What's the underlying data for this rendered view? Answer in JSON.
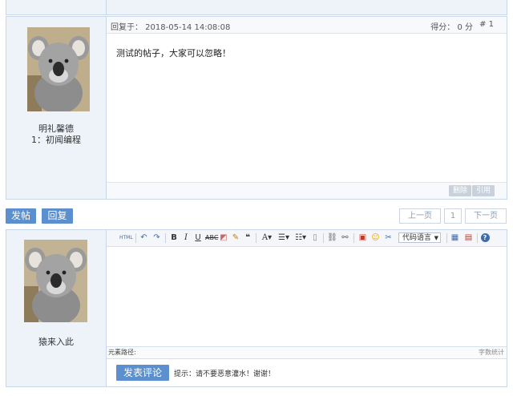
{
  "post": {
    "reply_time": "回复于： 2018-05-14 14:08:08",
    "score": "得分： 0 分",
    "floor": "# 1",
    "body": "测试的帖子，大家可以忽略！",
    "author_name": "明礼馨德",
    "author_level": "1：初闻编程",
    "delete_label": "删除",
    "quote_label": "引用"
  },
  "actions": {
    "post_label": "发帖",
    "reply_label": "回复"
  },
  "pager": {
    "prev_label": "上一页",
    "current_page": "1",
    "next_label": "下一页"
  },
  "editor": {
    "user_name": "猿来入此",
    "toolbar": {
      "html_label": "HTML",
      "code_language": "代码语言"
    },
    "path_label": "元素路径:",
    "count_label": "字数统计",
    "submit_label": "发表评论",
    "hint": "提示：请不要恶意灌水！谢谢！"
  },
  "icons": [
    "html-icon",
    "undo-icon",
    "redo-icon",
    "bold-icon",
    "italic-icon",
    "underline-icon",
    "strikethrough-icon",
    "eraser-icon",
    "format-brush-icon",
    "quote-icon",
    "font-color-icon",
    "ordered-list-icon",
    "unordered-list-icon",
    "page-icon",
    "link-icon",
    "unlink-icon",
    "image-icon",
    "emoticon-icon",
    "smiley-icon",
    "attachment-icon",
    "table-icon",
    "calendar-icon",
    "help-icon"
  ],
  "colors": {
    "accent_button": "#5b8fcd",
    "side_panel": "#eef3fa",
    "border": "#c8d6e6"
  }
}
